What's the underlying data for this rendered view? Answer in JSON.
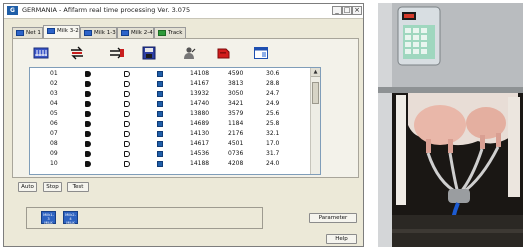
{
  "window": {
    "title": "GERMANIA - Afifarm real time processing Ver. 3.075",
    "min_label": "_",
    "max_label": "□",
    "close_label": "×"
  },
  "tabs": [
    {
      "label": "Net 1"
    },
    {
      "label": "Milk 3-2"
    },
    {
      "label": "Milk 1-3"
    },
    {
      "label": "Milk 2-4"
    },
    {
      "label": "Track"
    }
  ],
  "rows": [
    {
      "id": "01",
      "n1": "14108",
      "n2": "4590",
      "n3": "30.6"
    },
    {
      "id": "02",
      "n1": "14167",
      "n2": "3813",
      "n3": "28.8"
    },
    {
      "id": "03",
      "n1": "13932",
      "n2": "3050",
      "n3": "24.7"
    },
    {
      "id": "04",
      "n1": "14740",
      "n2": "3421",
      "n3": "24.9"
    },
    {
      "id": "05",
      "n1": "13880",
      "n2": "3579",
      "n3": "25.6"
    },
    {
      "id": "06",
      "n1": "14689",
      "n2": "1184",
      "n3": "25.8"
    },
    {
      "id": "07",
      "n1": "14130",
      "n2": "2176",
      "n3": "32.1"
    },
    {
      "id": "08",
      "n1": "14617",
      "n2": "4501",
      "n3": "17.0"
    },
    {
      "id": "09",
      "n1": "14536",
      "n2": "0736",
      "n3": "31.7"
    },
    {
      "id": "10",
      "n1": "14188",
      "n2": "4208",
      "n3": "24.0"
    }
  ],
  "buttons": {
    "auto": "Auto",
    "stop": "Stop",
    "test": "Test",
    "parameter": "Parameter",
    "help": "Help"
  },
  "status_tiles": [
    {
      "line1": "Milk1-3",
      "line2": "MILK"
    },
    {
      "line1": "Milk2-4",
      "line2": "MILK"
    }
  ],
  "colors": {
    "accent": "#2d62c0",
    "window_bg": "#ece9d8"
  }
}
